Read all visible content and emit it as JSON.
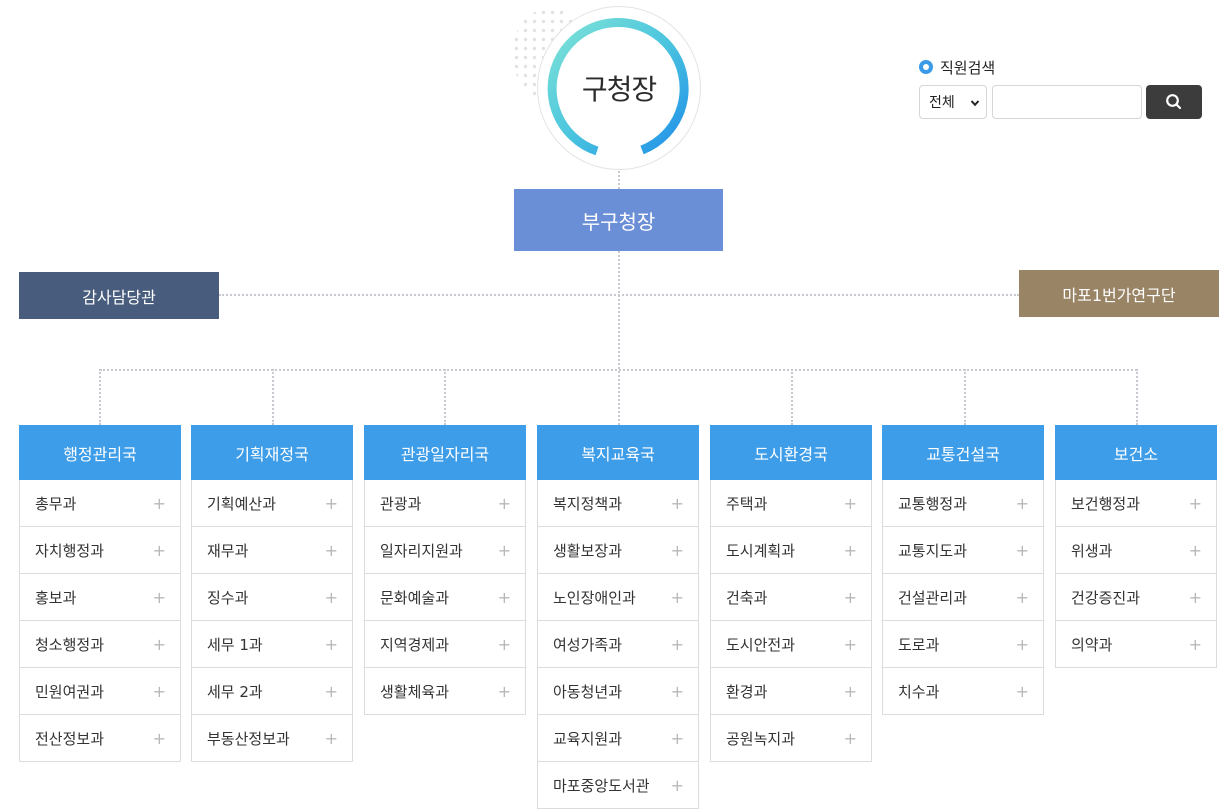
{
  "mayor": {
    "label": "구청장"
  },
  "deputy": {
    "label": "부구청장"
  },
  "audit": {
    "label": "감사담당관"
  },
  "research": {
    "label": "마포1번가연구단"
  },
  "search": {
    "radio_label": "직원검색",
    "select_value": "전체",
    "input_value": "",
    "input_placeholder": ""
  },
  "colors": {
    "column_header": "#3e9de8",
    "deputy": "#6b8fd6",
    "audit": "#485d7e",
    "research": "#9a8466",
    "search_button": "#3c3c3c"
  },
  "columns": [
    {
      "title": "행정관리국",
      "items": [
        {
          "label": "총무과",
          "icon": "+"
        },
        {
          "label": "자치행정과",
          "icon": "+"
        },
        {
          "label": "홍보과",
          "icon": "+"
        },
        {
          "label": "청소행정과",
          "icon": "+"
        },
        {
          "label": "민원여권과",
          "icon": "+"
        },
        {
          "label": "전산정보과",
          "icon": "+"
        }
      ]
    },
    {
      "title": "기획재정국",
      "items": [
        {
          "label": "기획예산과",
          "icon": "+"
        },
        {
          "label": "재무과",
          "icon": "+"
        },
        {
          "label": "징수과",
          "icon": "+"
        },
        {
          "label": "세무 1과",
          "icon": "+"
        },
        {
          "label": "세무 2과",
          "icon": "+"
        },
        {
          "label": "부동산정보과",
          "icon": "+"
        }
      ]
    },
    {
      "title": "관광일자리국",
      "items": [
        {
          "label": "관광과",
          "icon": "+"
        },
        {
          "label": "일자리지원과",
          "icon": "+"
        },
        {
          "label": "문화예술과",
          "icon": "+"
        },
        {
          "label": "지역경제과",
          "icon": "+"
        },
        {
          "label": "생활체육과",
          "icon": "+"
        }
      ]
    },
    {
      "title": "복지교육국",
      "items": [
        {
          "label": "복지정책과",
          "icon": "+"
        },
        {
          "label": "생활보장과",
          "icon": "+"
        },
        {
          "label": "노인장애인과",
          "icon": "+"
        },
        {
          "label": "여성가족과",
          "icon": "+"
        },
        {
          "label": "아동청년과",
          "icon": "+"
        },
        {
          "label": "교육지원과",
          "icon": "+"
        },
        {
          "label": "마포중앙도서관",
          "icon": "+"
        }
      ]
    },
    {
      "title": "도시환경국",
      "items": [
        {
          "label": "주택과",
          "icon": "+"
        },
        {
          "label": "도시계획과",
          "icon": "+"
        },
        {
          "label": "건축과",
          "icon": "+"
        },
        {
          "label": "도시안전과",
          "icon": "+"
        },
        {
          "label": "환경과",
          "icon": "+"
        },
        {
          "label": "공원녹지과",
          "icon": "+"
        }
      ]
    },
    {
      "title": "교통건설국",
      "items": [
        {
          "label": "교통행정과",
          "icon": "+"
        },
        {
          "label": "교통지도과",
          "icon": "+"
        },
        {
          "label": "건설관리과",
          "icon": "+"
        },
        {
          "label": "도로과",
          "icon": "+"
        },
        {
          "label": "치수과",
          "icon": "+"
        }
      ]
    },
    {
      "title": "보건소",
      "items": [
        {
          "label": "보건행정과",
          "icon": "+"
        },
        {
          "label": "위생과",
          "icon": "+"
        },
        {
          "label": "건강증진과",
          "icon": "+"
        },
        {
          "label": "의약과",
          "icon": "+"
        }
      ]
    }
  ]
}
